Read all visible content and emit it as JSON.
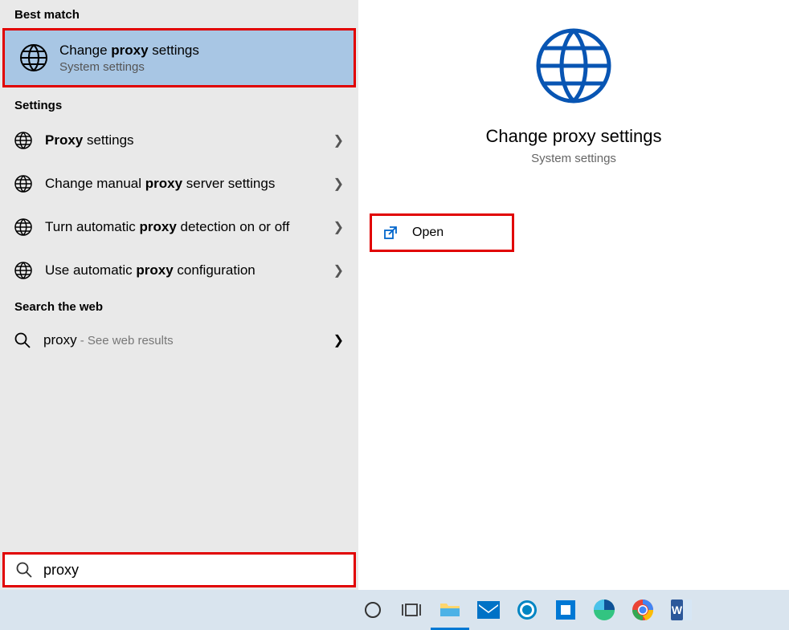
{
  "left": {
    "best_match_label": "Best match",
    "best_match": {
      "title_pre": "Change ",
      "title_bold": "proxy",
      "title_post": " settings",
      "subtitle": "System settings"
    },
    "settings_label": "Settings",
    "settings": [
      {
        "pre": "",
        "bold": "Proxy",
        "post": " settings"
      },
      {
        "pre": "Change manual ",
        "bold": "proxy",
        "post": " server settings"
      },
      {
        "pre": "Turn automatic ",
        "bold": "proxy",
        "post": " detection on or off"
      },
      {
        "pre": "Use automatic ",
        "bold": "proxy",
        "post": " configuration"
      }
    ],
    "web_label": "Search the web",
    "web": {
      "term": "proxy",
      "suffix": " - See web results"
    }
  },
  "right": {
    "title": "Change proxy settings",
    "subtitle": "System settings",
    "open_label": "Open"
  },
  "search": {
    "value": "proxy"
  },
  "colors": {
    "accent": "#0078d4",
    "highlight_border": "#e10000",
    "selected_bg": "#a8c6e4"
  }
}
